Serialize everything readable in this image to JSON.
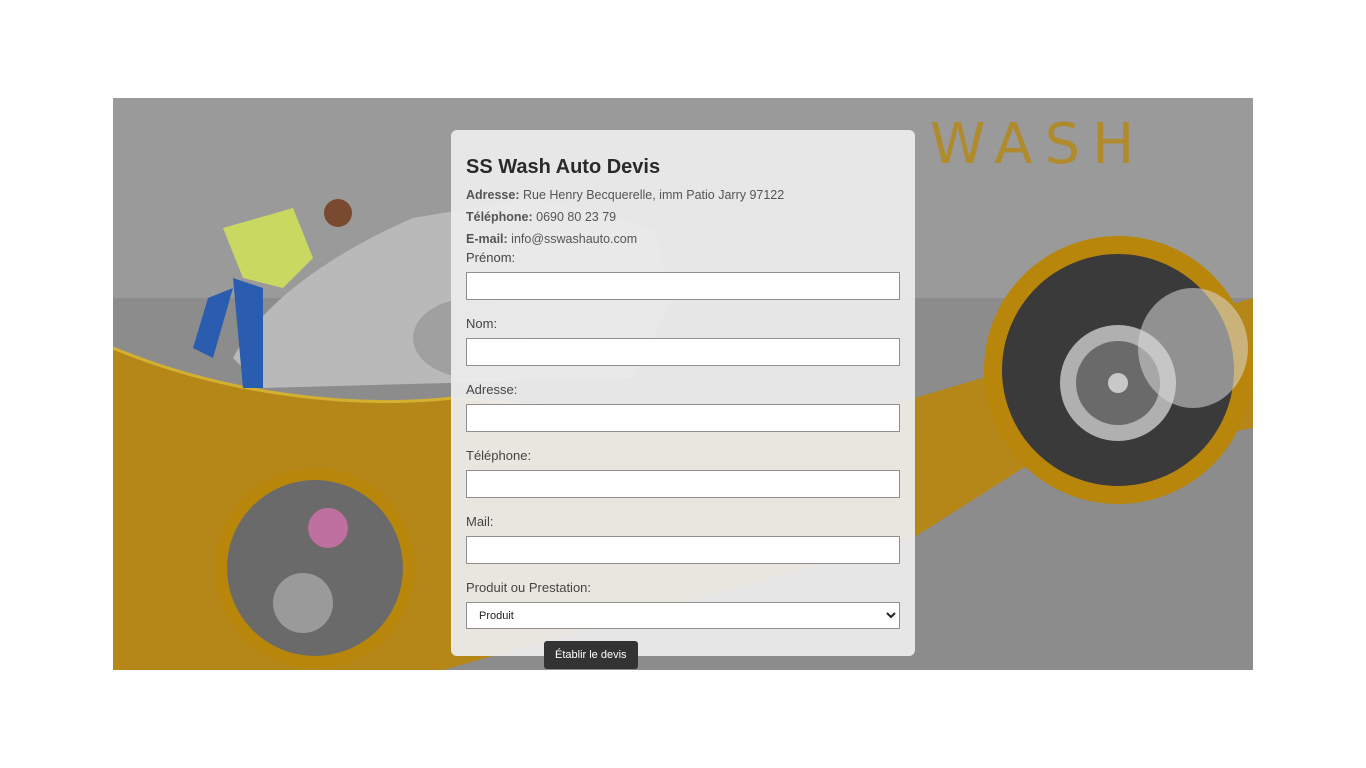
{
  "banner": {
    "brand_word": "WASH",
    "colors": {
      "background": "#8a8a8a",
      "gold": "#b8860b",
      "gold_edge": "#c8a020"
    }
  },
  "form": {
    "title": "SS Wash Auto Devis",
    "address_label": "Adresse:",
    "address_value": "Rue Henry Becquerelle, imm Patio Jarry 97122",
    "phone_label": "Téléphone:",
    "phone_value": "0690 80 23 79",
    "email_label": "E-mail:",
    "email_value": "info@sswashauto.com",
    "fields": {
      "prenom_label": "Prénom:",
      "nom_label": "Nom:",
      "adresse_label": "Adresse:",
      "telephone_label": "Téléphone:",
      "mail_label": "Mail:",
      "produit_label": "Produit ou Prestation:"
    },
    "product_select": {
      "selected": "Produit",
      "options": [
        "Produit"
      ]
    },
    "submit_label": "Établir le devis"
  }
}
